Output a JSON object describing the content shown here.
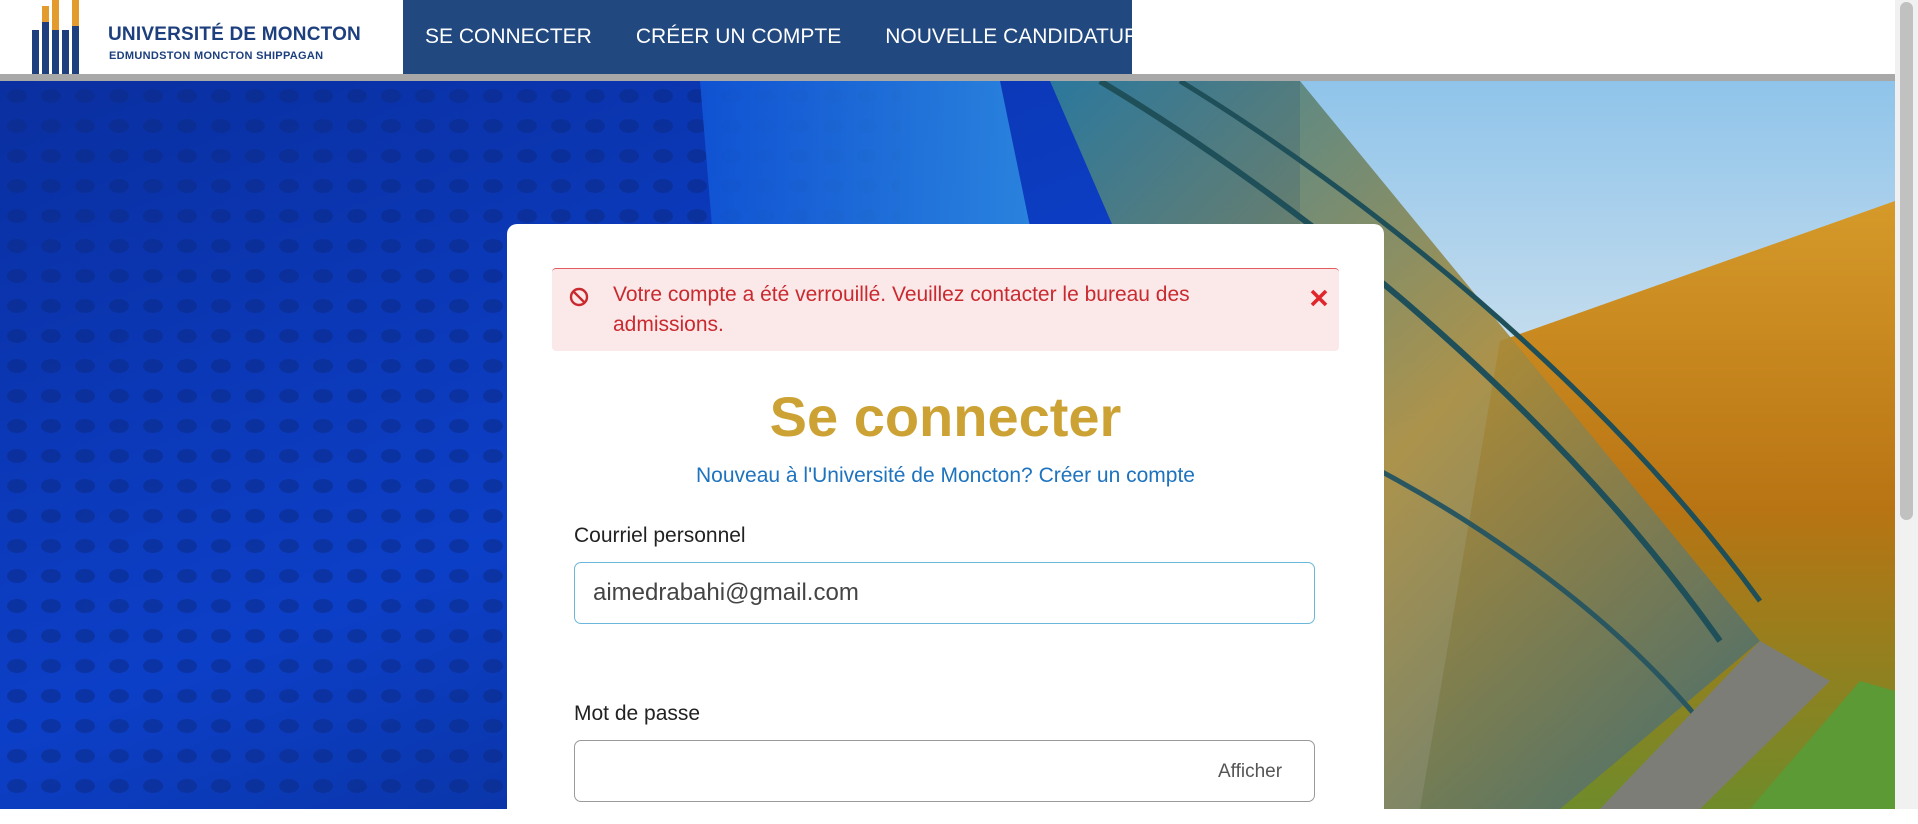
{
  "header": {
    "logo": {
      "title": "UNIVERSITÉ DE MONCTON",
      "subtitle": "EDMUNDSTON  MONCTON  SHIPPAGAN"
    },
    "nav": [
      {
        "label": "SE CONNECTER"
      },
      {
        "label": "CRÉER UN COMPTE"
      },
      {
        "label": "NOUVELLE CANDIDATURE"
      }
    ]
  },
  "login": {
    "alert": {
      "message": "Votre compte a été verrouillé. Veuillez contacter le bureau des admissions.",
      "icon": "ban-icon",
      "close_icon": "close-icon"
    },
    "title": "Se connecter",
    "register_prompt": "Nouveau à l'Université de Moncton?",
    "register_link": "Créer un compte",
    "email": {
      "label": "Courriel personnel",
      "value": "aimedrabahi@gmail.com"
    },
    "password": {
      "label": "Mot de passe",
      "value": "",
      "show_label": "Afficher"
    }
  },
  "colors": {
    "nav_bg": "#21487f",
    "title_gold": "#cda235",
    "link_blue": "#1e73be",
    "alert_bg": "#fbe9ea",
    "alert_text": "#c92a2f"
  }
}
